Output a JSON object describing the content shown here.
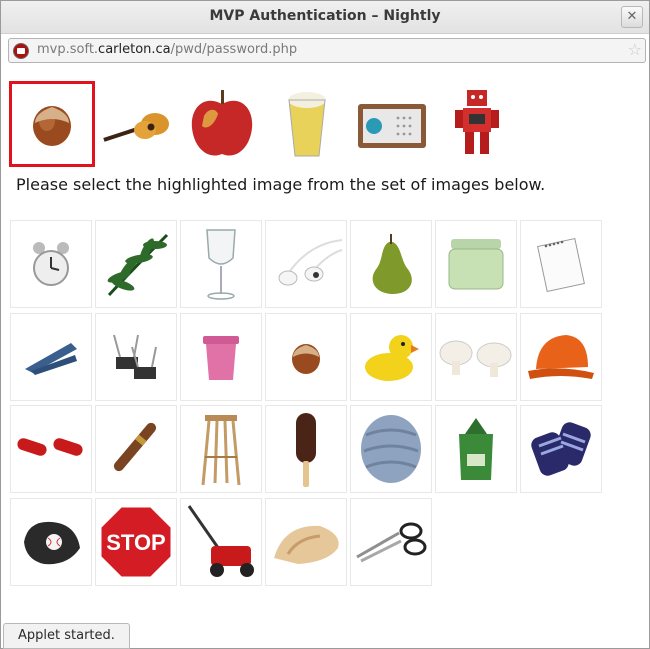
{
  "window": {
    "title": "MVP Authentication – Nightly"
  },
  "url": {
    "prefix": "mvp.soft.",
    "domain": "carleton.ca",
    "path": "/pwd/password.php"
  },
  "targets": [
    "hazelnut",
    "guitar",
    "apple",
    "beer-glass",
    "radio",
    "robot"
  ],
  "selected_target": "hazelnut",
  "prompt": "Please select the highlighted image from the set of images below.",
  "grid": [
    "alarm-clock",
    "fern-leaf",
    "wine-glass",
    "earbuds",
    "pear",
    "glass-jar",
    "notepad",
    "clothespin",
    "binder-clips",
    "pink-bin",
    "hazelnut",
    "rubber-duck",
    "mushrooms",
    "hard-hat",
    "red-capsules",
    "cigar",
    "wooden-stool",
    "ice-cream-bar",
    "sleeping-bag",
    "tea-bag",
    "gloves",
    "baseball-glove",
    "stop-sign",
    "lawn-mower",
    "seashell",
    "scissors"
  ],
  "stop_sign_text": "STOP",
  "status": "Applet started."
}
